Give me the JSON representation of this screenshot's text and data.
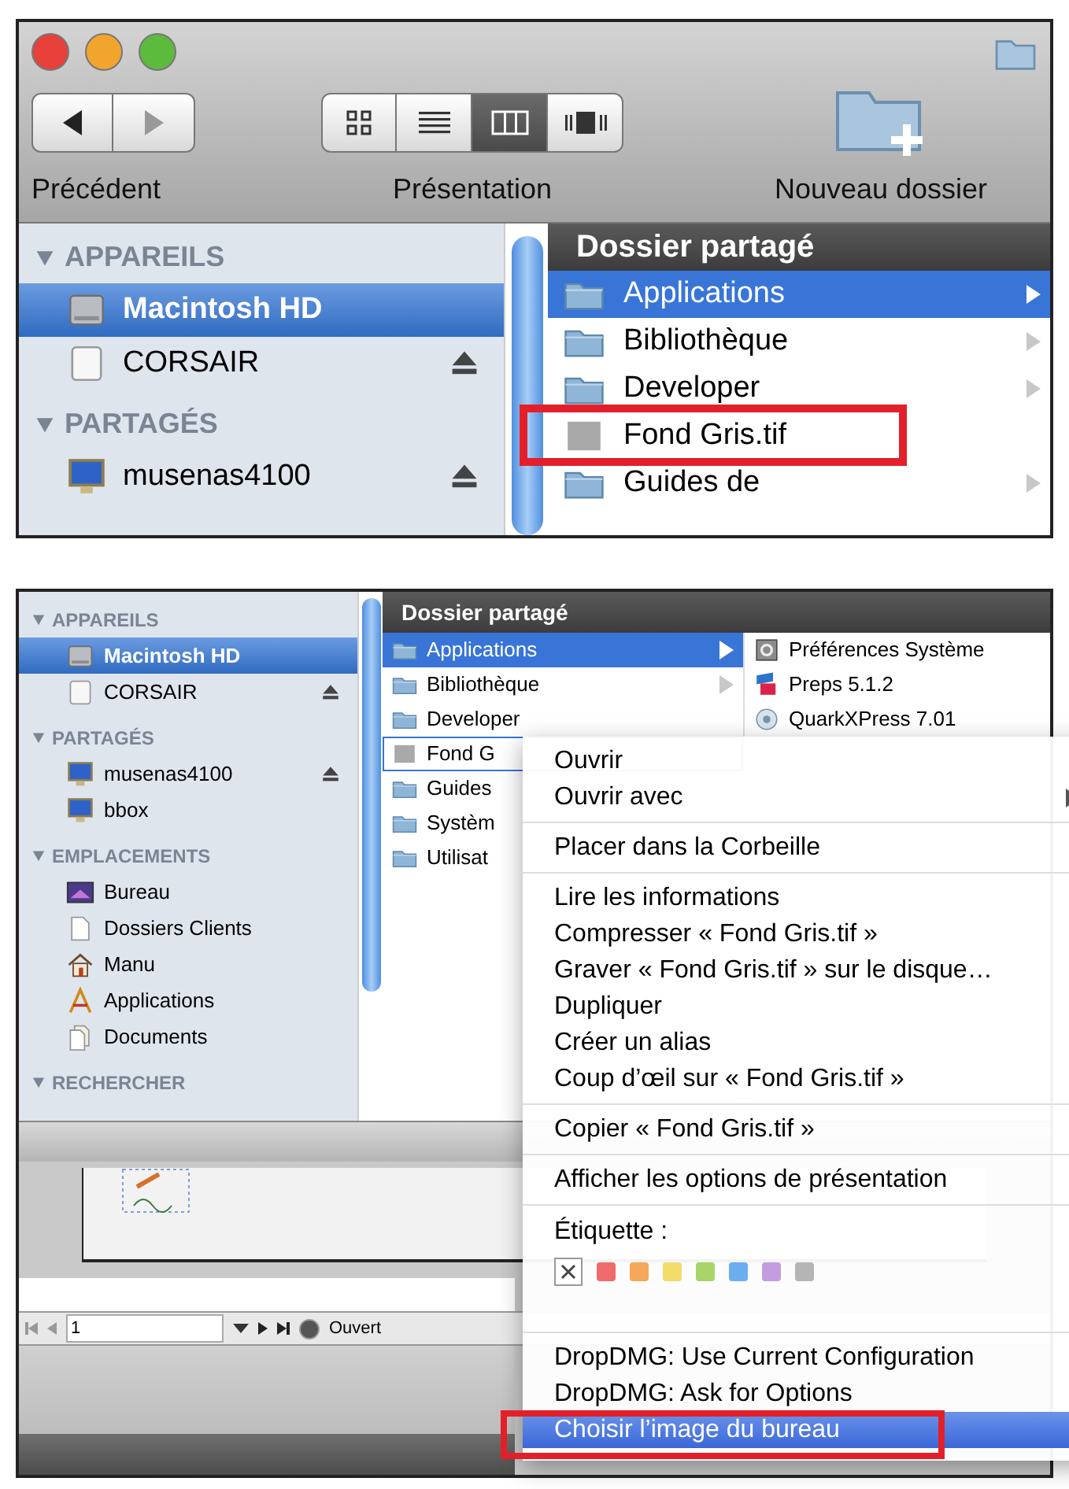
{
  "top_window": {
    "toolbar": {
      "back_label": "Précédent",
      "view_label": "Présentation",
      "new_folder_label": "Nouveau dossier",
      "view_modes": [
        {
          "kind": "icons",
          "selected": false
        },
        {
          "kind": "list",
          "selected": false
        },
        {
          "kind": "columns",
          "selected": true
        },
        {
          "kind": "coverflow",
          "selected": false
        }
      ]
    },
    "sidebar": {
      "sections": [
        {
          "title": "APPAREILS",
          "expanded": true,
          "items": [
            {
              "name": "Macintosh HD",
              "kind": "hd",
              "selected": true,
              "eject": false
            },
            {
              "name": "CORSAIR",
              "kind": "drive",
              "selected": false,
              "eject": true
            }
          ]
        },
        {
          "title": "PARTAGÉS",
          "expanded": true,
          "items": [
            {
              "name": "musenas4100",
              "kind": "network",
              "selected": false,
              "eject": true
            }
          ]
        }
      ]
    },
    "column": {
      "title": "Dossier partagé",
      "items": [
        {
          "name": "Applications",
          "kind": "apps_folder",
          "selected": true,
          "has_children": true
        },
        {
          "name": "Bibliothèque",
          "kind": "library_folder",
          "selected": false,
          "has_children": true
        },
        {
          "name": "Developer",
          "kind": "dev_folder",
          "selected": false,
          "has_children": true
        },
        {
          "name": "Fond Gris.tif",
          "kind": "image",
          "selected": false,
          "has_children": false
        },
        {
          "name": "Guides de",
          "kind": "alias_folder",
          "selected": false,
          "has_children": true
        }
      ]
    }
  },
  "bottom_window": {
    "sidebar": {
      "sections": [
        {
          "title": "APPAREILS",
          "expanded": true,
          "items": [
            {
              "name": "Macintosh HD",
              "kind": "hd",
              "selected": true,
              "eject": false
            },
            {
              "name": "CORSAIR",
              "kind": "drive",
              "selected": false,
              "eject": true
            }
          ]
        },
        {
          "title": "PARTAGÉS",
          "expanded": true,
          "items": [
            {
              "name": "musenas4100",
              "kind": "network",
              "selected": false,
              "eject": true
            },
            {
              "name": "bbox",
              "kind": "network",
              "selected": false,
              "eject": false
            }
          ]
        },
        {
          "title": "EMPLACEMENTS",
          "expanded": true,
          "items": [
            {
              "name": "Bureau",
              "kind": "desktop",
              "selected": false,
              "eject": false
            },
            {
              "name": "Dossiers Clients",
              "kind": "file",
              "selected": false,
              "eject": false
            },
            {
              "name": "Manu",
              "kind": "home",
              "selected": false,
              "eject": false
            },
            {
              "name": "Applications",
              "kind": "apps",
              "selected": false,
              "eject": false
            },
            {
              "name": "Documents",
              "kind": "docs",
              "selected": false,
              "eject": false
            }
          ]
        },
        {
          "title": "RECHERCHER",
          "expanded": true
        }
      ]
    },
    "column_title": "Dossier partagé",
    "columns": [
      {
        "items": [
          {
            "name": "Applications",
            "kind": "apps_folder",
            "selected": true,
            "outlined": false,
            "has_children": true
          },
          {
            "name": "Bibliothèque",
            "kind": "library_folder",
            "selected": false,
            "outlined": false,
            "has_children": true
          },
          {
            "name": "Developer",
            "kind": "dev_folder",
            "selected": false,
            "outlined": false,
            "has_children": false
          },
          {
            "name": "Fond G",
            "kind": "image",
            "selected": false,
            "outlined": true,
            "has_children": false
          },
          {
            "name": "Guides",
            "kind": "alias_folder",
            "selected": false,
            "outlined": false,
            "has_children": false
          },
          {
            "name": "Systèm",
            "kind": "system_folder",
            "selected": false,
            "outlined": false,
            "has_children": false
          },
          {
            "name": "Utilisat",
            "kind": "users_folder",
            "selected": false,
            "outlined": false,
            "has_children": false
          }
        ]
      },
      {
        "items": [
          {
            "name": "Préférences Système",
            "kind": "prefs",
            "selected": false,
            "outlined": false,
            "has_children": false
          },
          {
            "name": "Preps 5.1.2",
            "kind": "app",
            "selected": false,
            "outlined": false,
            "has_children": false
          },
          {
            "name": "QuarkXPress 7.01",
            "kind": "quark",
            "selected": false,
            "outlined": false,
            "has_children": false
          }
        ]
      }
    ],
    "document": {
      "page": "1",
      "status": "Ouvert"
    }
  },
  "context_menu": {
    "groups": [
      {
        "kind": "items",
        "items": [
          {
            "label": "Ouvrir",
            "submenu": false,
            "selected": false
          },
          {
            "label": "Ouvrir avec",
            "submenu": true,
            "selected": false
          }
        ]
      },
      {
        "kind": "items",
        "items": [
          {
            "label": "Placer dans la Corbeille",
            "submenu": false,
            "selected": false
          }
        ]
      },
      {
        "kind": "items",
        "items": [
          {
            "label": "Lire les informations",
            "submenu": false,
            "selected": false
          },
          {
            "label": "Compresser « Fond Gris.tif »",
            "submenu": false,
            "selected": false
          },
          {
            "label": "Graver « Fond Gris.tif » sur le disque…",
            "submenu": false,
            "selected": false
          },
          {
            "label": "Dupliquer",
            "submenu": false,
            "selected": false
          },
          {
            "label": "Créer un alias",
            "submenu": false,
            "selected": false
          },
          {
            "label": "Coup d’œil sur « Fond Gris.tif »",
            "submenu": false,
            "selected": false
          }
        ]
      },
      {
        "kind": "items",
        "items": [
          {
            "label": "Copier « Fond Gris.tif »",
            "submenu": false,
            "selected": false
          }
        ]
      },
      {
        "kind": "items",
        "items": [
          {
            "label": "Afficher les options de présentation",
            "submenu": false,
            "selected": false
          }
        ]
      },
      {
        "kind": "labels",
        "title": "Étiquette :",
        "colors": [
          {
            "color": "#f06b6b"
          },
          {
            "color": "#f5a85a"
          },
          {
            "color": "#f2dc6a"
          },
          {
            "color": "#a9d46a"
          },
          {
            "color": "#6aaef0"
          },
          {
            "color": "#c39ddf"
          },
          {
            "color": "#b5b5b5"
          }
        ]
      },
      {
        "kind": "items",
        "items": [
          {
            "label": "DropDMG: Use Current Configuration",
            "submenu": false,
            "selected": false
          },
          {
            "label": "DropDMG: Ask for Options",
            "submenu": false,
            "selected": false
          },
          {
            "label": "Choisir l’image du bureau",
            "submenu": false,
            "selected": true
          }
        ]
      }
    ]
  }
}
